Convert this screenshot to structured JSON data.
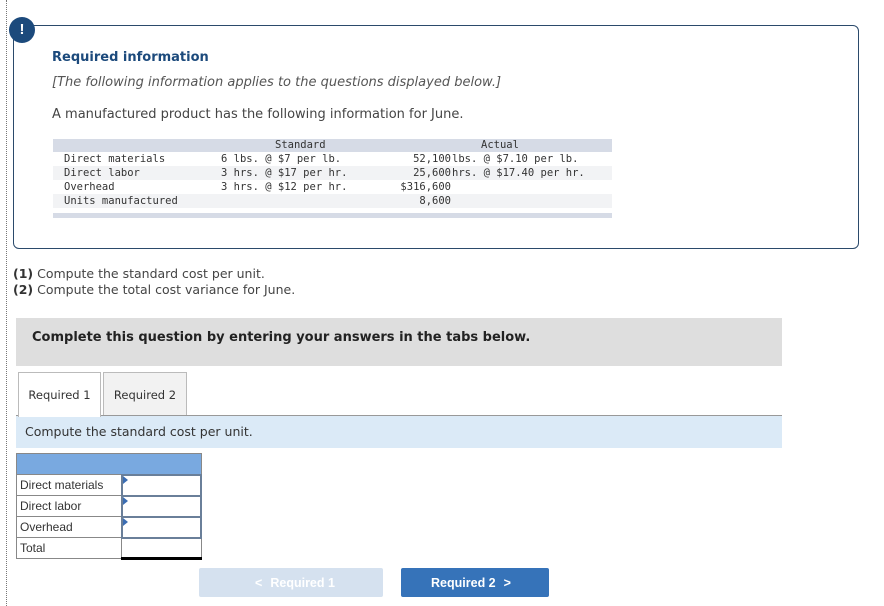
{
  "alert_icon": "exclamation-icon",
  "info": {
    "title": "Required information",
    "note": "[The following information applies to the questions displayed below.]",
    "intro": "A manufactured product has the following information for June."
  },
  "data_table": {
    "headers": {
      "standard": "Standard",
      "actual": "Actual"
    },
    "rows": [
      {
        "label": "Direct materials",
        "standard": "6 lbs. @ $7 per lb.",
        "actual_qty": "52,100",
        "actual_rest": "lbs. @ $7.10 per lb."
      },
      {
        "label": "Direct labor",
        "standard": "3 hrs. @ $17 per hr.",
        "actual_qty": "25,600",
        "actual_rest": "hrs. @ $17.40 per hr."
      },
      {
        "label": "Overhead",
        "standard": "3 hrs. @ $12 per hr.",
        "actual_qty": "$316,600",
        "actual_rest": ""
      },
      {
        "label": "Units manufactured",
        "standard": "",
        "actual_qty": "8,600",
        "actual_rest": ""
      }
    ]
  },
  "questions": [
    {
      "num": "(1)",
      "text": "Compute the standard cost per unit."
    },
    {
      "num": "(2)",
      "text": "Compute the total cost variance for June."
    }
  ],
  "instruction": "Complete this question by entering your answers in the tabs below.",
  "tabs": [
    {
      "label": "Required 1",
      "active": true
    },
    {
      "label": "Required 2",
      "active": false
    }
  ],
  "prompt": "Compute the standard cost per unit.",
  "answer_table": {
    "rows": [
      {
        "label": "Direct materials",
        "value": ""
      },
      {
        "label": "Direct labor",
        "value": ""
      },
      {
        "label": "Overhead",
        "value": ""
      },
      {
        "label": "Total",
        "value": ""
      }
    ]
  },
  "nav": {
    "prev_label": "Required 1",
    "next_label": "Required 2",
    "prev_icon": "chevron-left-icon",
    "next_icon": "chevron-right-icon"
  },
  "colors": {
    "accent": "#1c4a7c",
    "next_button": "#3673b9",
    "prev_button_disabled": "#d5e1ef",
    "answer_header": "#79a9e0",
    "prompt_bg": "#dbeaf7"
  }
}
